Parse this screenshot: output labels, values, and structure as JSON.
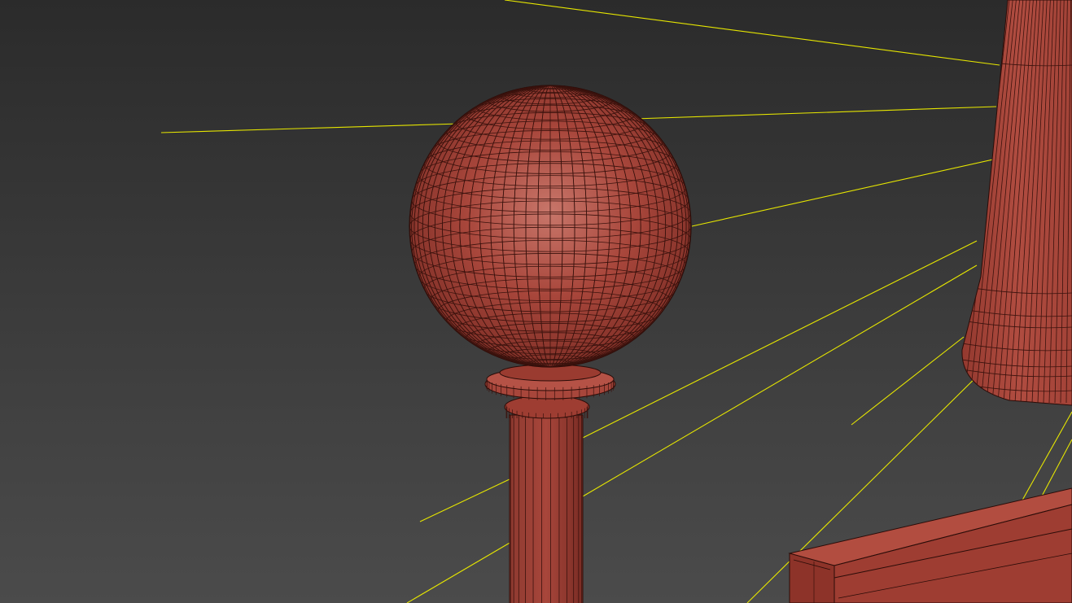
{
  "viewport": {
    "background_top": "#2b2b2b",
    "background_bottom": "#4b4b4b"
  },
  "colors": {
    "mesh_fill": "#a8463b",
    "mesh_light": "#c8766a",
    "mesh_dark": "#6a2620",
    "wire": "#2a0c08",
    "light_ray": "#e6e600"
  },
  "objects": [
    "sphere-lamp-globe",
    "lamp-post",
    "cylinder-lamp-shade",
    "box-base",
    "yellow-light-rays"
  ]
}
